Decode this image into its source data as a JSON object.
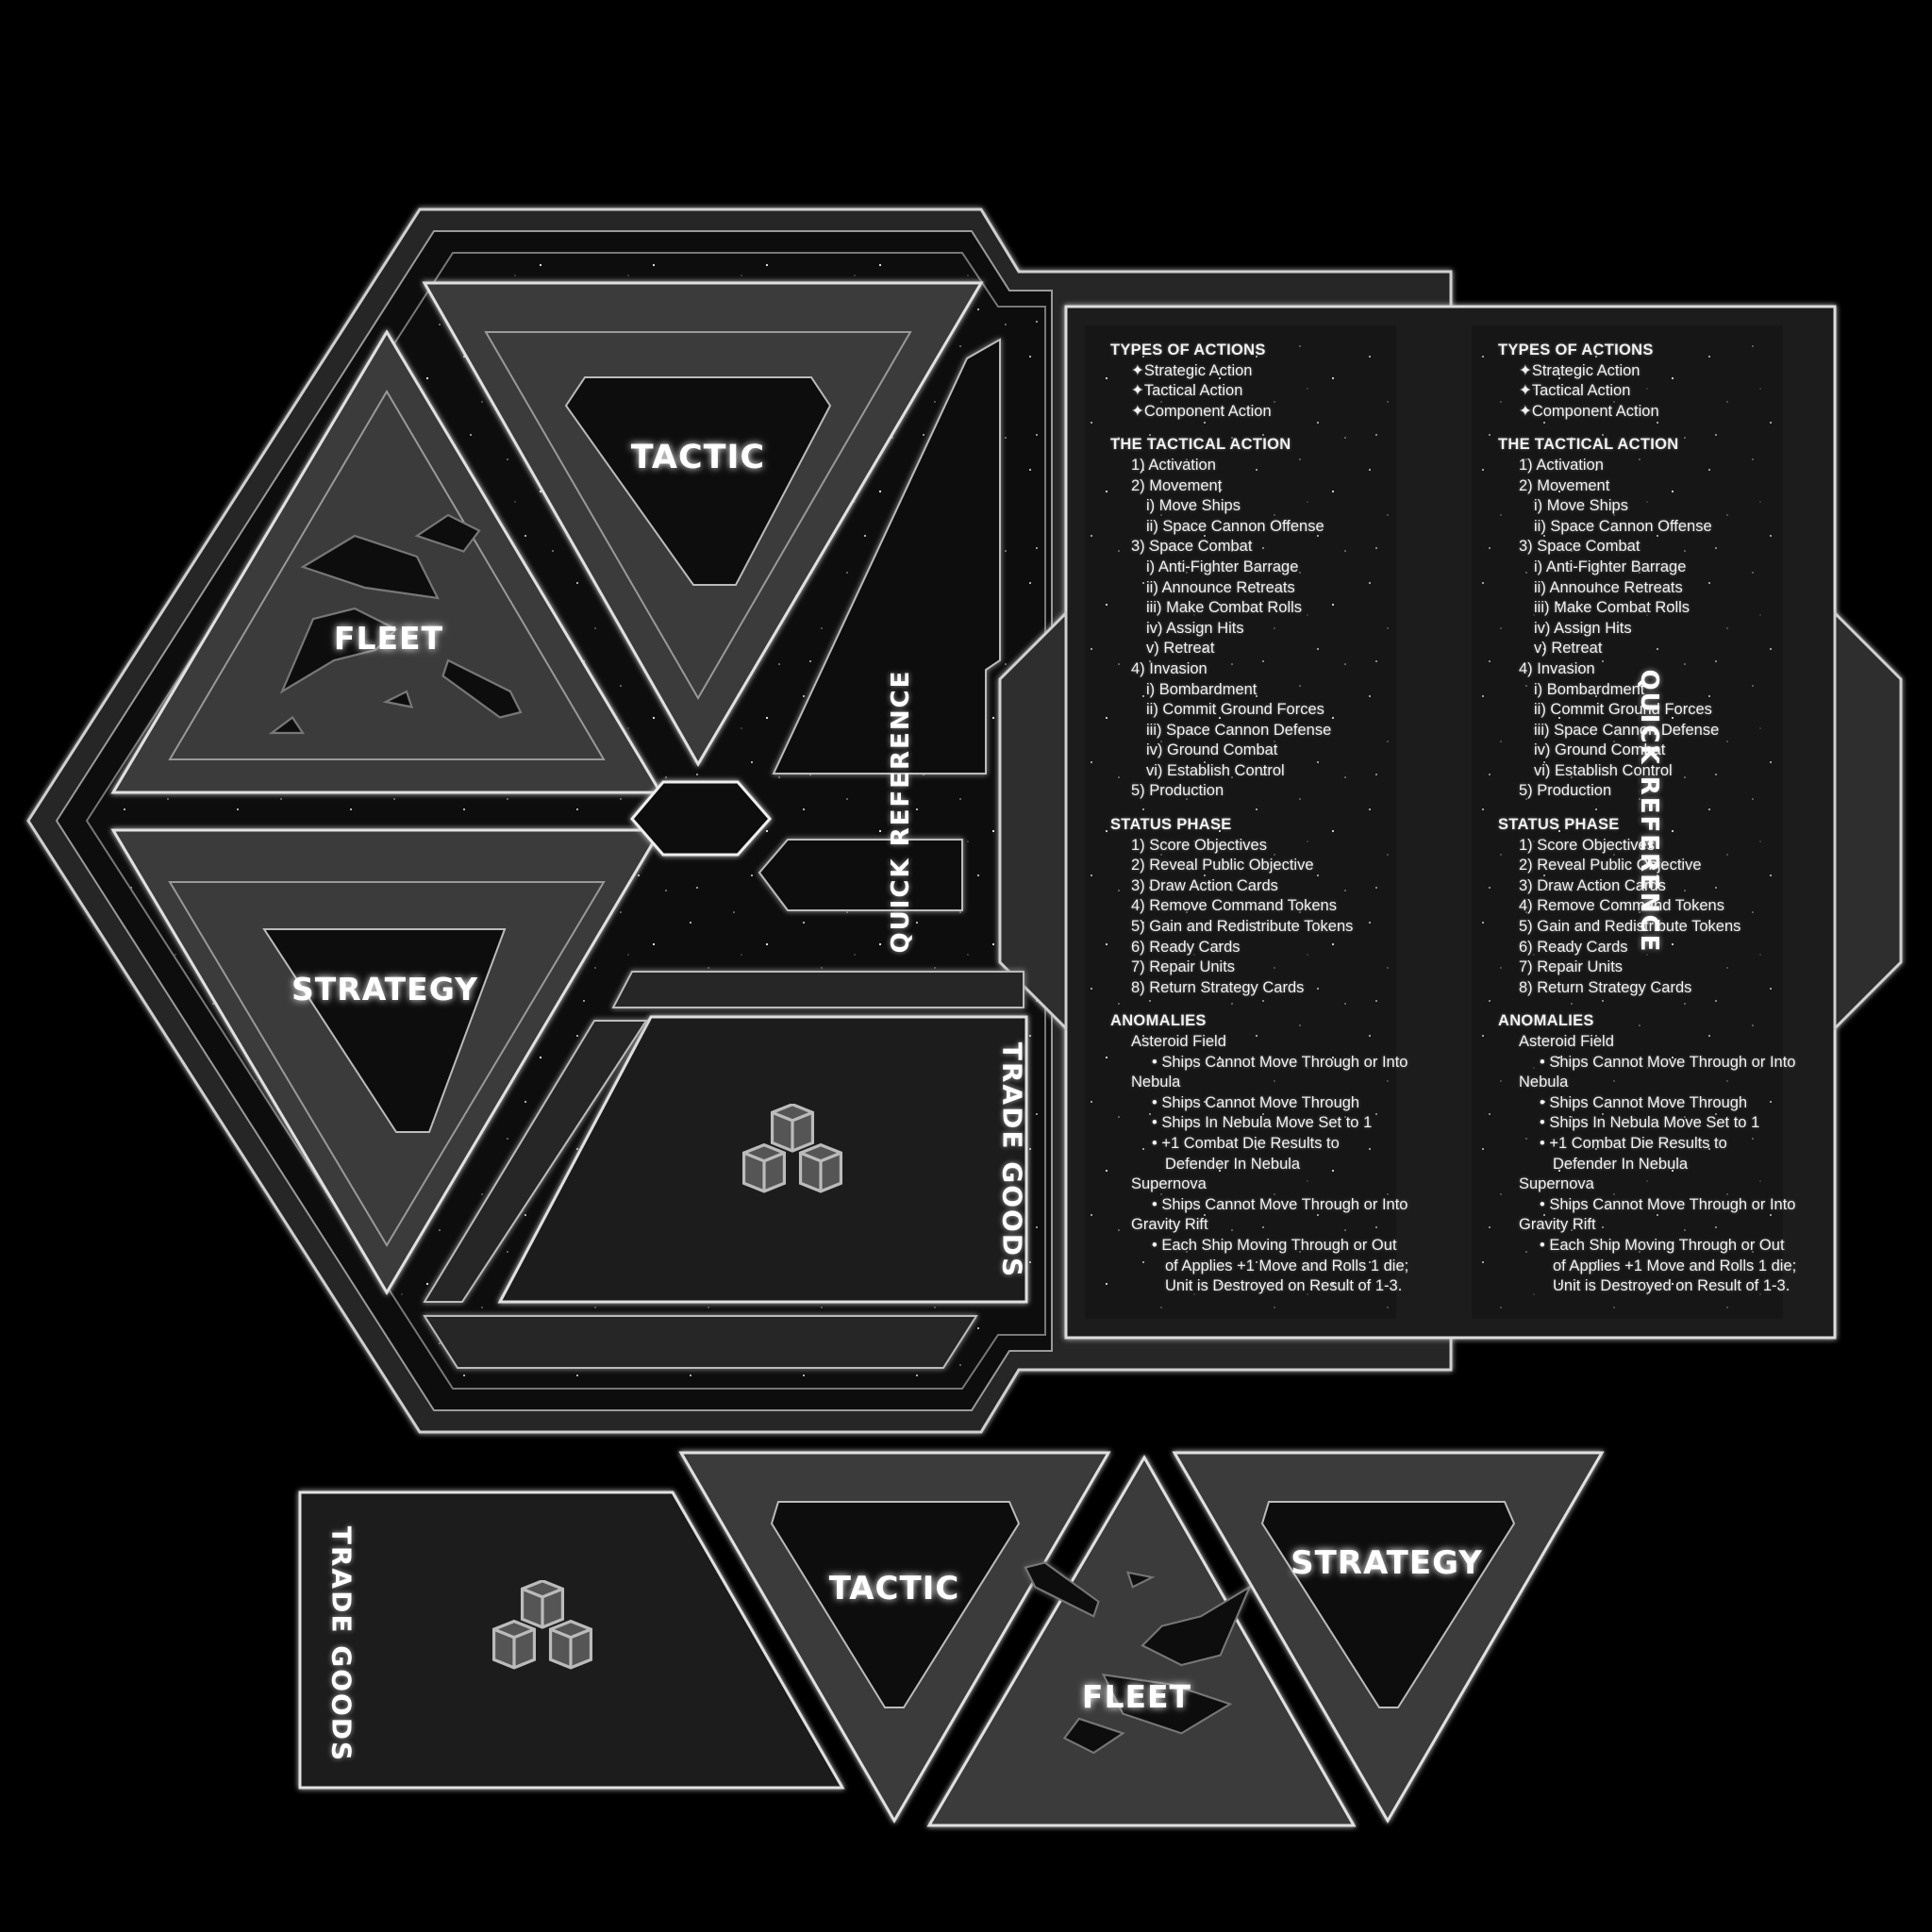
{
  "tiles": {
    "fleet_main": "FLEET",
    "tactic_main": "TACTIC",
    "strategy_main": "STRATEGY",
    "trade_goods_main": "TRADE GOODS",
    "trade_goods_extra": "TRADE GOODS",
    "tactic_extra": "TACTIC",
    "fleet_extra": "FLEET",
    "strategy_extra": "STRATEGY"
  },
  "quick_reference": {
    "tab_label": "QUICK REFERENCE",
    "columns": [
      {
        "lines": [
          {
            "t": "TYPES OF ACTIONS",
            "c": "hd"
          },
          {
            "t": "✦Strategic Action",
            "c": "i1"
          },
          {
            "t": "✦Tactical Action",
            "c": "i1"
          },
          {
            "t": "✦Component Action",
            "c": "i1"
          },
          {
            "t": "",
            "c": "gap"
          },
          {
            "t": "THE TACTICAL ACTION",
            "c": "hd"
          },
          {
            "t": "1) Activation",
            "c": "i1"
          },
          {
            "t": "2) Movement",
            "c": "i1"
          },
          {
            "t": "i) Move Ships",
            "c": "i2"
          },
          {
            "t": "ii) Space Cannon Offense",
            "c": "i2"
          },
          {
            "t": "3) Space Combat",
            "c": "i1"
          },
          {
            "t": "i) Anti-Fighter Barrage",
            "c": "i2"
          },
          {
            "t": "ii) Announce Retreats",
            "c": "i2"
          },
          {
            "t": "iii) Make Combat Rolls",
            "c": "i2"
          },
          {
            "t": "iv) Assign Hits",
            "c": "i2"
          },
          {
            "t": "v) Retreat",
            "c": "i2"
          },
          {
            "t": "4) Invasion",
            "c": "i1"
          },
          {
            "t": "i) Bombardment",
            "c": "i2"
          },
          {
            "t": "ii) Commit Ground Forces",
            "c": "i2"
          },
          {
            "t": "iii) Space Cannon Defense",
            "c": "i2"
          },
          {
            "t": "iv) Ground Combat",
            "c": "i2"
          },
          {
            "t": "vi) Establish Control",
            "c": "i2"
          },
          {
            "t": "5) Production",
            "c": "i1"
          },
          {
            "t": "",
            "c": "gap"
          },
          {
            "t": "STATUS PHASE",
            "c": "hd"
          },
          {
            "t": "1) Score Objectives",
            "c": "i1"
          },
          {
            "t": "2) Reveal Public Objective",
            "c": "i1"
          },
          {
            "t": "3) Draw Action Cards",
            "c": "i1"
          },
          {
            "t": "4) Remove Command Tokens",
            "c": "i1"
          },
          {
            "t": "5) Gain and Redistribute Tokens",
            "c": "i1"
          },
          {
            "t": "6) Ready Cards",
            "c": "i1"
          },
          {
            "t": "7) Repair Units",
            "c": "i1"
          },
          {
            "t": "8) Return Strategy Cards",
            "c": "i1"
          },
          {
            "t": "",
            "c": "gap"
          },
          {
            "t": "ANOMALIES",
            "c": "hd"
          },
          {
            "t": "Asteroid Field",
            "c": "i1"
          },
          {
            "t": "• Ships Cannot Move Through or Into",
            "c": "i3"
          },
          {
            "t": "Nebula",
            "c": "i1"
          },
          {
            "t": "• Ships Cannot Move Through",
            "c": "i3"
          },
          {
            "t": "• Ships In Nebula Move Set to 1",
            "c": "i3"
          },
          {
            "t": "• +1 Combat Die Results to",
            "c": "i3"
          },
          {
            "t": "Defender In Nebula",
            "c": "i4"
          },
          {
            "t": "Supernova",
            "c": "i1"
          },
          {
            "t": "• Ships Cannot Move Through or Into",
            "c": "i3"
          },
          {
            "t": "Gravity Rift",
            "c": "i1"
          },
          {
            "t": "• Each Ship Moving Through or Out",
            "c": "i3"
          },
          {
            "t": "of Applies +1 Move and Rolls 1 die;",
            "c": "i4"
          },
          {
            "t": "Unit is Destroyed on Result of 1-3.",
            "c": "i4"
          }
        ]
      },
      {
        "lines": [
          {
            "t": "TYPES OF ACTIONS",
            "c": "hd"
          },
          {
            "t": "✦Strategic Action",
            "c": "i1"
          },
          {
            "t": "✦Tactical Action",
            "c": "i1"
          },
          {
            "t": "✦Component Action",
            "c": "i1"
          },
          {
            "t": "",
            "c": "gap"
          },
          {
            "t": "THE TACTICAL ACTION",
            "c": "hd"
          },
          {
            "t": "1) Activation",
            "c": "i1"
          },
          {
            "t": "2) Movement",
            "c": "i1"
          },
          {
            "t": "i) Move Ships",
            "c": "i2"
          },
          {
            "t": "ii) Space Cannon Offense",
            "c": "i2"
          },
          {
            "t": "3) Space Combat",
            "c": "i1"
          },
          {
            "t": "i) Anti-Fighter Barrage",
            "c": "i2"
          },
          {
            "t": "ii) Announce Retreats",
            "c": "i2"
          },
          {
            "t": "iii) Make Combat Rolls",
            "c": "i2"
          },
          {
            "t": "iv) Assign Hits",
            "c": "i2"
          },
          {
            "t": "v) Retreat",
            "c": "i2"
          },
          {
            "t": "4) Invasion",
            "c": "i1"
          },
          {
            "t": "i) Bombardment",
            "c": "i2"
          },
          {
            "t": "ii) Commit Ground Forces",
            "c": "i2"
          },
          {
            "t": "iii) Space Cannon Defense",
            "c": "i2"
          },
          {
            "t": "iv) Ground Combat",
            "c": "i2"
          },
          {
            "t": "vi) Establish Control",
            "c": "i2"
          },
          {
            "t": "5) Production",
            "c": "i1"
          },
          {
            "t": "",
            "c": "gap"
          },
          {
            "t": "STATUS PHASE",
            "c": "hd"
          },
          {
            "t": "1) Score Objectives",
            "c": "i1"
          },
          {
            "t": "2) Reveal Public Objective",
            "c": "i1"
          },
          {
            "t": "3) Draw Action Cards",
            "c": "i1"
          },
          {
            "t": "4) Remove Command Tokens",
            "c": "i1"
          },
          {
            "t": "5) Gain and Redistribute Tokens",
            "c": "i1"
          },
          {
            "t": "6) Ready Cards",
            "c": "i1"
          },
          {
            "t": "7) Repair Units",
            "c": "i1"
          },
          {
            "t": "8) Return Strategy Cards",
            "c": "i1"
          },
          {
            "t": "",
            "c": "gap"
          },
          {
            "t": "ANOMALIES",
            "c": "hd"
          },
          {
            "t": "Asteroid Field",
            "c": "i1"
          },
          {
            "t": "• Ships Cannot Move Through or Into",
            "c": "i3"
          },
          {
            "t": "Nebula",
            "c": "i1"
          },
          {
            "t": "• Ships Cannot Move Through",
            "c": "i3"
          },
          {
            "t": "• Ships In Nebula Move Set to 1",
            "c": "i3"
          },
          {
            "t": "• +1 Combat Die Results to",
            "c": "i3"
          },
          {
            "t": "Defender In Nebula",
            "c": "i4"
          },
          {
            "t": "Supernova",
            "c": "i1"
          },
          {
            "t": "• Ships Cannot Move Through or Into",
            "c": "i3"
          },
          {
            "t": "Gravity Rift",
            "c": "i1"
          },
          {
            "t": "• Each Ship Moving Through or Out",
            "c": "i3"
          },
          {
            "t": "of Applies +1 Move and Rolls 1 die;",
            "c": "i4"
          },
          {
            "t": "Unit is Destroyed on Result of 1-3.",
            "c": "i4"
          }
        ]
      }
    ]
  },
  "colors": {
    "background": "#000000",
    "tile_fill": "#3a3a3a",
    "frame_fill": "#2a2a2a",
    "glow": "#e8e8e8"
  }
}
